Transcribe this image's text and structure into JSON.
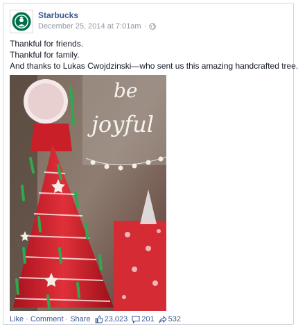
{
  "post": {
    "page_name": "Starbucks",
    "timestamp": "December 25, 2014 at 7:01am",
    "separator": "·",
    "audience_icon": "globe-icon",
    "text_lines": [
      "Thankful for friends.",
      "Thankful for family.",
      "And thanks to Lukas Cwojdzinski—who sent us this amazing handcrafted tree."
    ],
    "photo": {
      "overlay_lines": [
        "be",
        "joyful"
      ]
    }
  },
  "actions": {
    "like_label": "Like",
    "comment_label": "Comment",
    "share_label": "Share",
    "dot": "·",
    "likes_count": "23,023",
    "comments_count": "201",
    "shares_count": "532"
  },
  "colors": {
    "link": "#3b5998",
    "meta": "#9197a3",
    "brand_green": "#00704a"
  }
}
